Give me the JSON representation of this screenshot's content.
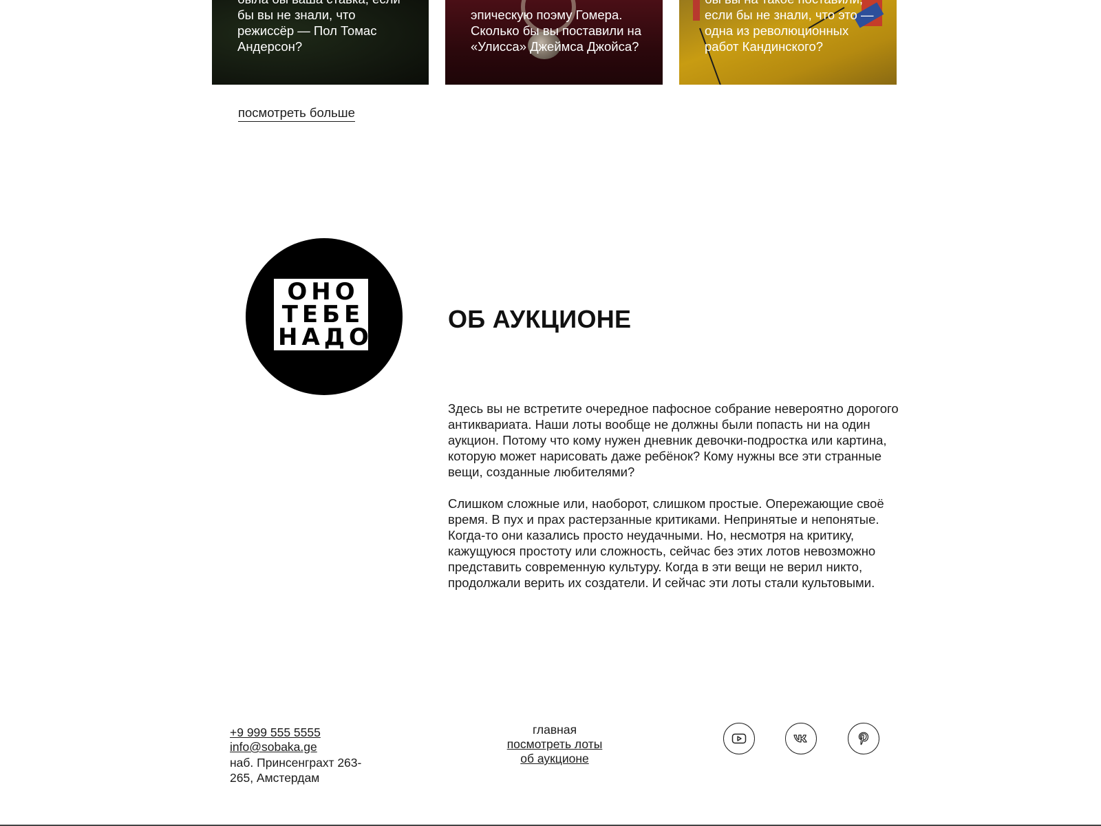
{
  "cards": [
    {
      "text": "была бы ваша ставка, если бы вы не знали, что режиссёр — Пол Томас Андерсон?"
    },
    {
      "text": "эпическую поэму Гомера. Сколько бы вы поставили на «Улисса» Джеймса Джойса?"
    },
    {
      "text": "бы вы на такое поставили, если бы не знали, что это — одна из революционных работ Кандинского?"
    }
  ],
  "more_link": "посмотреть больше",
  "logo": {
    "lines": [
      "ОНО",
      "ТЕБЕ",
      "НАДО"
    ]
  },
  "about": {
    "title": "ОБ АУКЦИОНЕ",
    "paragraphs": [
      "Здесь вы не встретите очередное пафосное собрание невероятно дорогого антиквариата. Наши лоты вообще не должны были попасть ни на один аукцион. Потому что кому нужен дневник девочки-подростка или картина, которую может нарисовать даже ребёнок? Кому нужны все эти странные вещи, созданные любителями?",
      "Слишком сложные или, наоборот, слишком простые. Опережающие своё время. В пух и прах растерзанные критиками. Непринятые и непонятые. Когда-то они казались просто неудачными. Но, несмотря на критику, кажущуюся простоту или сложность, сейчас без этих лотов невозможно представить современную культуру. Когда в эти вещи не верил никто, продолжали верить их создатели. И сейчас эти лоты стали культовыми."
    ]
  },
  "footer": {
    "phone": "+9 999 555 5555",
    "email": "info@sobaka.ge",
    "address": "наб. Принсенграхт 263-265, Амстердам",
    "nav": [
      "главная",
      "посмотреть лоты",
      "об аукционе"
    ],
    "social": [
      "youtube-icon",
      "vk-icon",
      "pinterest-icon"
    ]
  }
}
